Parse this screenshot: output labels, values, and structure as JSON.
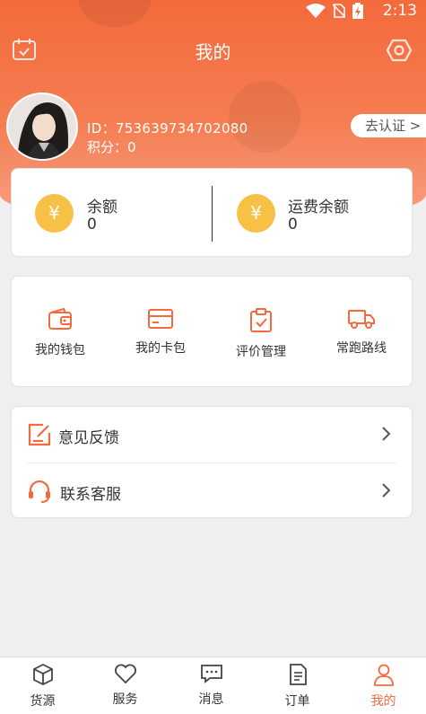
{
  "status": {
    "time": "2:13"
  },
  "header": {
    "title": "我的"
  },
  "user": {
    "id_text": "ID：753639734702080",
    "points_text": "积分：0",
    "verify_label": "去认证 >"
  },
  "balance": {
    "left": {
      "icon_glyph": "¥",
      "label": "余额",
      "value": "0"
    },
    "right": {
      "icon_glyph": "¥",
      "label": "运费余额",
      "value": "0"
    }
  },
  "tools": [
    {
      "label": "我的钱包",
      "icon": "wallet-icon"
    },
    {
      "label": "我的卡包",
      "icon": "card-icon"
    },
    {
      "label": "评价管理",
      "icon": "clipboard-check-icon"
    },
    {
      "label": "常跑路线",
      "icon": "truck-icon"
    }
  ],
  "menu": [
    {
      "label": "意见反馈",
      "icon": "feedback-edit-icon"
    },
    {
      "label": "联系客服",
      "icon": "headset-icon"
    }
  ],
  "tabbar": [
    {
      "label": "货源",
      "icon": "cube-icon"
    },
    {
      "label": "服务",
      "icon": "heart-icon"
    },
    {
      "label": "消息",
      "icon": "chat-icon"
    },
    {
      "label": "订单",
      "icon": "document-icon"
    },
    {
      "label": "我的",
      "icon": "person-icon",
      "active": true
    }
  ],
  "colors": {
    "accent": "#f36a3e",
    "coin": "#f7c046",
    "header_top": "#f46a3c"
  }
}
